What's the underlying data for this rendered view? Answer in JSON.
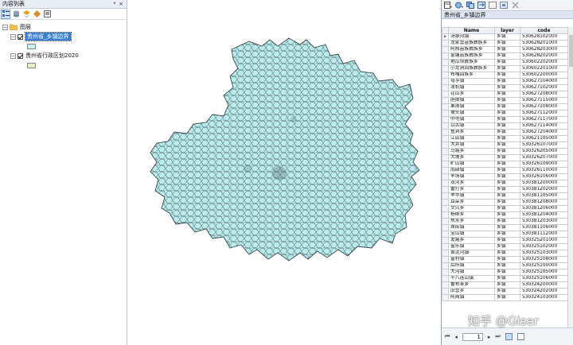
{
  "toc": {
    "title": "内容列表",
    "pin_glyph": "ᵠ",
    "close_glyph": "×",
    "layers_group": "图层",
    "layer1": {
      "name": "贵州省_乡镇边界",
      "fill": "#c8f1ef"
    },
    "layer2": {
      "name": "贵州省行政区划2020",
      "fill": "#e3efc7"
    }
  },
  "map": {
    "fill": "#b9ecec",
    "stroke": "#3b4a4f"
  },
  "table": {
    "title": "贵州省_乡镇边界",
    "columns": [
      "Name",
      "layer",
      "code"
    ],
    "rows": [
      [
        "汤泉河镇",
        "乡镇",
        "530628102000"
      ],
      [
        "龙家营苗族彝族乡",
        "乡镇",
        "530628201000"
      ],
      [
        "阿照苗族彝族乡",
        "乡镇",
        "530628203000"
      ],
      [
        "金塘苗族彝族乡",
        "乡镇",
        "530628202000"
      ],
      [
        "地瓜坝彝族乡",
        "乡镇",
        "530602202000"
      ],
      [
        "小龙洞回族彝族乡",
        "乡镇",
        "530602201000"
      ],
      [
        "布嘎回族乡",
        "乡镇",
        "530602200000"
      ],
      [
        "母亨镇",
        "乡镇",
        "530627104000"
      ],
      [
        "泼机镇",
        "乡镇",
        "530627102000"
      ],
      [
        "花山乡",
        "乡镇",
        "530627208000"
      ],
      [
        "胆拨镇",
        "乡镇",
        "530627115000"
      ],
      [
        "果珠镇",
        "乡镇",
        "530627108000"
      ],
      [
        "坡头镇",
        "乡镇",
        "530627112000"
      ],
      [
        "中屯镇",
        "乡镇",
        "530627117000"
      ],
      [
        "以古镇",
        "乡镇",
        "530627114000"
      ],
      [
        "鱼洞乡",
        "乡镇",
        "530627204000"
      ],
      [
        "江底镇",
        "乡镇",
        "530621105000"
      ],
      [
        "大井镇",
        "乡镇",
        "530326107000"
      ],
      [
        "马路乡",
        "乡镇",
        "530326205000"
      ],
      [
        "大坡乡",
        "乡镇",
        "530326207000"
      ],
      [
        "旷山镇",
        "乡镇",
        "530326109000"
      ],
      [
        "雨碌镇",
        "乡镇",
        "530326110000"
      ],
      [
        "羊场镇",
        "乡镇",
        "530326106000"
      ],
      [
        "双河乡",
        "乡镇",
        "530381200000"
      ],
      [
        "雷打乡",
        "乡镇",
        "530381202000"
      ],
      [
        "丰华镇",
        "乡镇",
        "530381105000"
      ],
      [
        "耳朵乡",
        "乡镇",
        "530381208000"
      ],
      [
        "文兴乡",
        "乡镇",
        "530381206000"
      ],
      [
        "杨柳乡",
        "乡镇",
        "530381204000"
      ],
      [
        "热水乡",
        "乡镇",
        "530381203000"
      ],
      [
        "珠街镇",
        "乡镇",
        "530381106000"
      ],
      [
        "宝山镇",
        "乡镇",
        "530381112000"
      ],
      [
        "发路乡",
        "乡镇",
        "530325201000"
      ],
      [
        "富乐镇",
        "乡镇",
        "530325102000"
      ],
      [
        "黄泥河镇",
        "乡镇",
        "530325103000"
      ],
      [
        "富村镇",
        "乡镇",
        "530325108000"
      ],
      [
        "后所镇",
        "乡镇",
        "530325100000"
      ],
      [
        "大河镇",
        "乡镇",
        "530325105000"
      ],
      [
        "十八连山镇",
        "乡镇",
        "530325106000"
      ],
      [
        "鲁布革乡",
        "乡镇",
        "530324200000"
      ],
      [
        "旧营乡",
        "乡镇",
        "530324202000"
      ],
      [
        "阿岗镇",
        "乡镇",
        "530324103000"
      ]
    ],
    "page_value": "1",
    "first_glyph": "⏮",
    "prev_glyph": "◂",
    "next_glyph": "▸",
    "last_glyph": "⏭"
  },
  "watermark": "知乎 @Giser",
  "colors": {
    "accent": "#3b7fd1",
    "panel_border": "#9aa4b3"
  }
}
